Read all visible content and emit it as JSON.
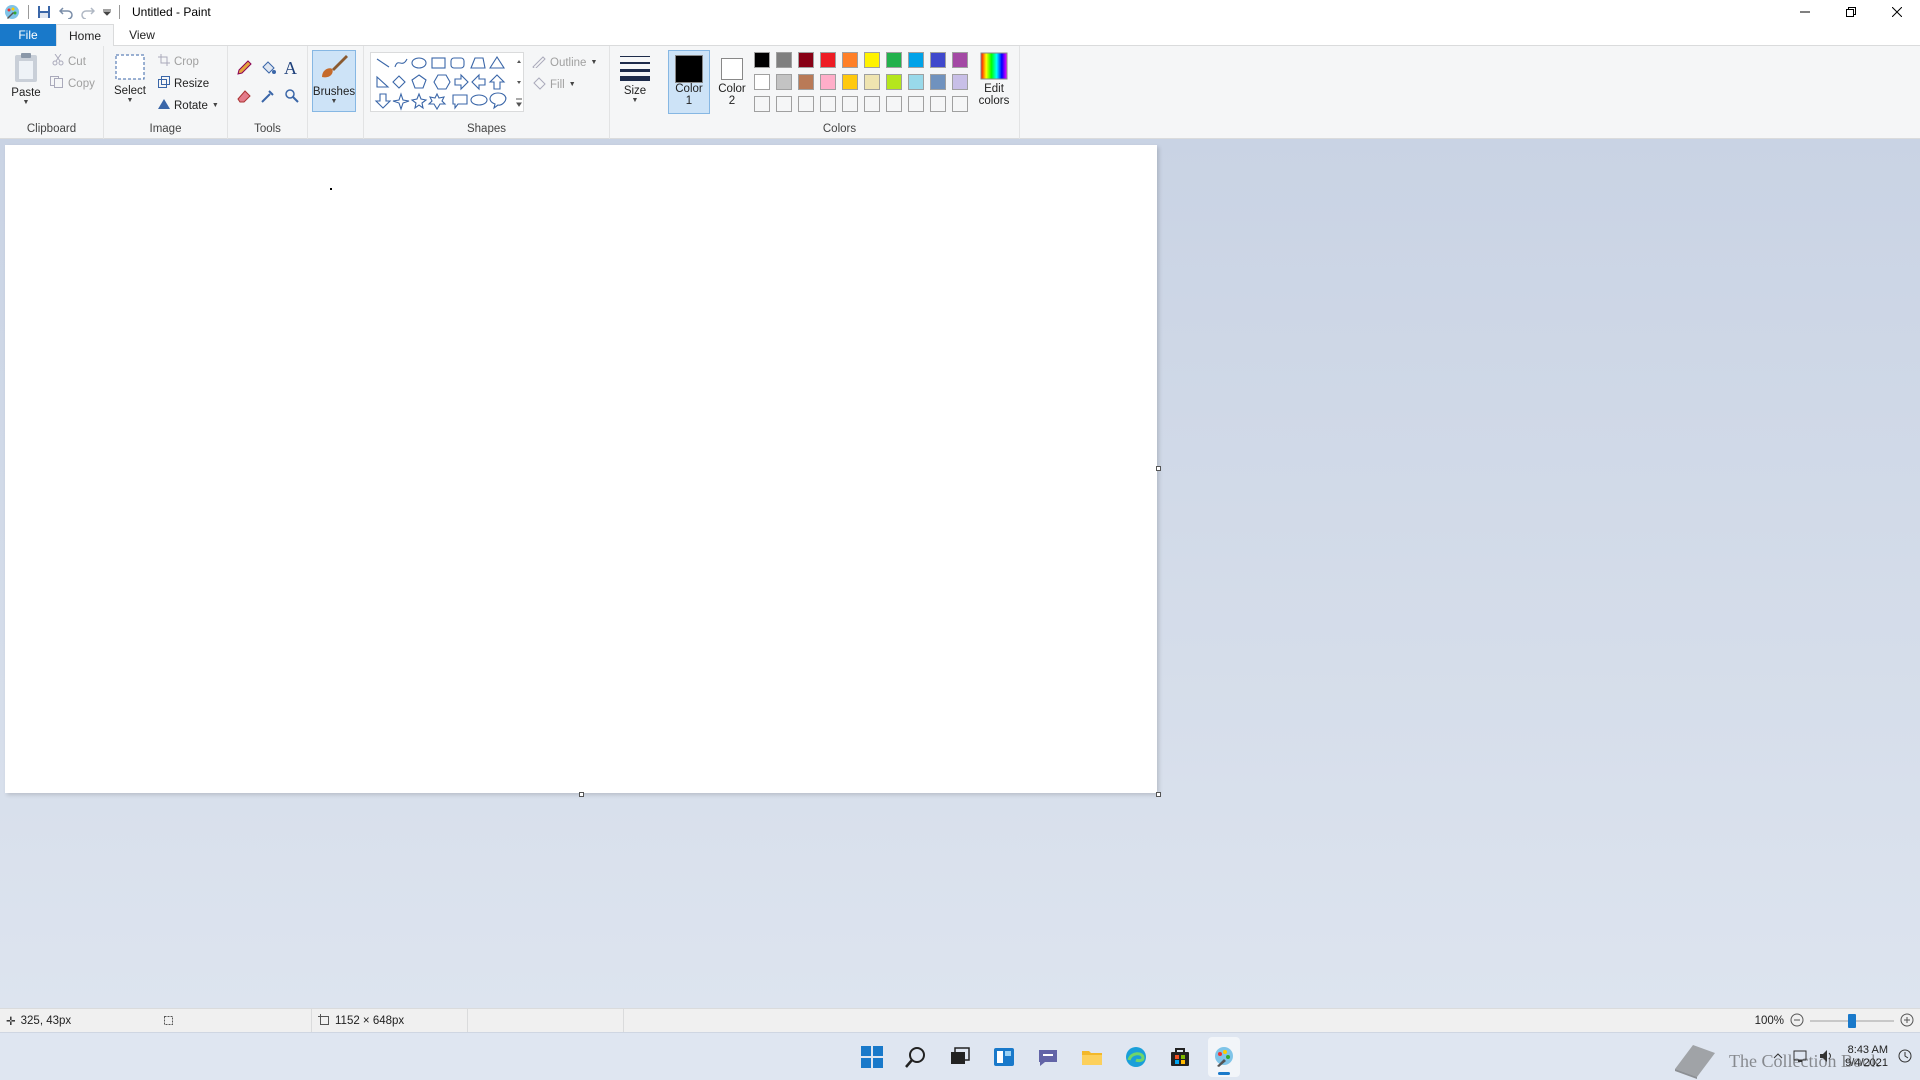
{
  "window": {
    "title": "Untitled - Paint",
    "controls": [
      "minimize-icon",
      "restore-icon",
      "close-icon"
    ]
  },
  "tabs": [
    {
      "label": "File"
    },
    {
      "label": "Home"
    },
    {
      "label": "View"
    }
  ],
  "ribbon": {
    "clipboard": {
      "label": "Clipboard",
      "paste": "Paste",
      "cut": "Cut",
      "copy": "Copy"
    },
    "image": {
      "label": "Image",
      "select": "Select",
      "crop": "Crop",
      "resize": "Resize",
      "rotate": "Rotate"
    },
    "tools": {
      "label": "Tools"
    },
    "brushes": {
      "label": "Brushes"
    },
    "shapes": {
      "label": "Shapes",
      "outline": "Outline",
      "fill": "Fill"
    },
    "size": {
      "label": "Size"
    },
    "colors": {
      "label": "Colors",
      "color1": "Color\n1",
      "color1_a": "Color",
      "color1_b": "1",
      "color2_a": "Color",
      "color2_b": "2",
      "edit_a": "Edit",
      "edit_b": "colors",
      "color1_value": "#000000",
      "color2_value": "#ffffff",
      "palette_row1": [
        "#000000",
        "#7f7f7f",
        "#880015",
        "#ed1c24",
        "#ff7f27",
        "#fff200",
        "#22b14c",
        "#00a2e8",
        "#3f48cc",
        "#a349a4"
      ],
      "palette_row2": [
        "#ffffff",
        "#c3c3c3",
        "#b97a57",
        "#ffaec9",
        "#ffc90e",
        "#efe4b0",
        "#b5e61d",
        "#99d9ea",
        "#7092be",
        "#c8bfe7"
      ],
      "palette_row3": [
        "#f5f6f7",
        "#f5f6f7",
        "#f5f6f7",
        "#f5f6f7",
        "#f5f6f7",
        "#f5f6f7",
        "#f5f6f7",
        "#f5f6f7",
        "#f5f6f7",
        "#f5f6f7"
      ]
    }
  },
  "status": {
    "cursor_pos": "325, 43px",
    "image_size": "1152 × 648px",
    "zoom": "100%"
  },
  "taskbar": {
    "icons": [
      "windows-start-icon",
      "search-icon",
      "task-view-icon",
      "widgets-icon",
      "teams-chat-icon",
      "file-explorer-icon",
      "edge-icon",
      "store-icon",
      "paint-icon"
    ],
    "time": "8:43 AM",
    "date": "9/4/2021",
    "watermark": "The Collection Book"
  }
}
